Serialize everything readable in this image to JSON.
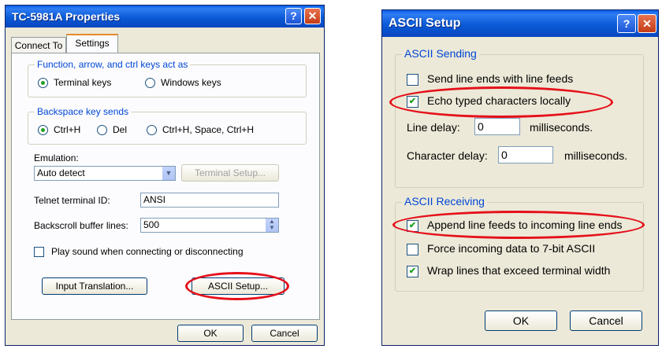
{
  "props": {
    "title": "TC-5981A Properties",
    "help_glyph": "?",
    "close_glyph": "✕",
    "tabs": [
      "Connect To",
      "Settings"
    ],
    "function_group": {
      "legend": "Function, arrow, and ctrl keys act as",
      "options": [
        "Terminal keys",
        "Windows keys"
      ],
      "selected": "Terminal keys"
    },
    "backspace_group": {
      "legend": "Backspace key sends",
      "options": [
        "Ctrl+H",
        "Del",
        "Ctrl+H, Space, Ctrl+H"
      ],
      "selected": "Ctrl+H"
    },
    "emulation_label": "Emulation:",
    "emulation_value": "Auto detect",
    "terminal_setup_label": "Terminal Setup...",
    "telnet_label": "Telnet terminal ID:",
    "telnet_value": "ANSI",
    "backscroll_label": "Backscroll buffer lines:",
    "backscroll_value": "500",
    "play_sound_label": "Play sound when connecting or disconnecting",
    "input_translation_label": "Input Translation...",
    "ascii_setup_label": "ASCII Setup...",
    "ok_label": "OK",
    "cancel_label": "Cancel"
  },
  "ascii": {
    "title": "ASCII Setup",
    "help_glyph": "?",
    "close_glyph": "✕",
    "sending": {
      "legend": "ASCII Sending",
      "send_line_ends_label": "Send line ends with line feeds",
      "send_line_ends_checked": false,
      "echo_label": "Echo typed characters locally",
      "echo_checked": true,
      "line_delay_label": "Line delay:",
      "line_delay_value": "0",
      "line_delay_unit": "milliseconds.",
      "char_delay_label": "Character delay:",
      "char_delay_value": "0",
      "char_delay_unit": "milliseconds."
    },
    "receiving": {
      "legend": "ASCII Receiving",
      "append_label": "Append line feeds to incoming line ends",
      "append_checked": true,
      "force_label": "Force incoming data to 7-bit ASCII",
      "force_checked": false,
      "wrap_label": "Wrap lines that exceed terminal width",
      "wrap_checked": true
    },
    "ok_label": "OK",
    "cancel_label": "Cancel"
  },
  "check_glyph": "✔",
  "colors": {
    "highlight": "#e5101a",
    "title_blue": "#0a5ad6",
    "legend_blue": "#0046d5"
  }
}
